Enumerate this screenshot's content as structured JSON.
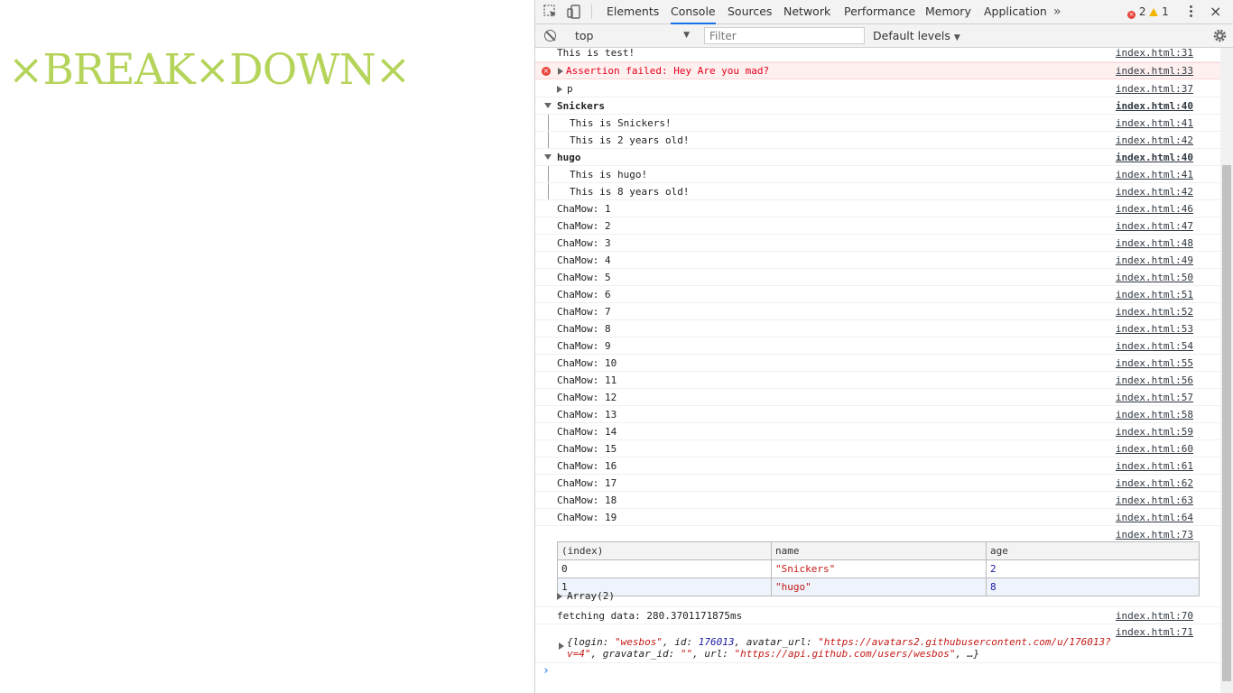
{
  "page": {
    "title": "×BREAK×DOWN×"
  },
  "devtools": {
    "tabs": [
      {
        "label": "Elements"
      },
      {
        "label": "Console"
      },
      {
        "label": "Sources"
      },
      {
        "label": "Network"
      },
      {
        "label": "Performance"
      },
      {
        "label": "Memory"
      },
      {
        "label": "Application"
      }
    ],
    "more_tabs": "»",
    "error_count": "2",
    "warning_count": "1",
    "close": "×",
    "colors": {
      "accent": "#1a73e8",
      "error": "#e8453c",
      "warning": "#f4b400"
    }
  },
  "toolbar": {
    "context": "top",
    "filter_placeholder": "Filter",
    "levels": "Default levels"
  },
  "console": {
    "messages": [
      {
        "text": "This is test!",
        "src": "index.html:31"
      },
      {
        "text": "Assertion failed: Hey Are you mad?",
        "src": "index.html:33"
      },
      {
        "text": "p",
        "src": "index.html:37"
      },
      {
        "text": "Snickers",
        "src": "index.html:40"
      },
      {
        "text": "This is Snickers!",
        "src": "index.html:41"
      },
      {
        "text": "This is 2 years old!",
        "src": "index.html:42"
      },
      {
        "text": "hugo",
        "src": "index.html:40"
      },
      {
        "text": "This is hugo!",
        "src": "index.html:41"
      },
      {
        "text": "This is 8 years old!",
        "src": "index.html:42"
      }
    ],
    "chamow": [
      {
        "text": "ChaMow: 1",
        "src": "index.html:46"
      },
      {
        "text": "ChaMow: 2",
        "src": "index.html:47"
      },
      {
        "text": "ChaMow: 3",
        "src": "index.html:48"
      },
      {
        "text": "ChaMow: 4",
        "src": "index.html:49"
      },
      {
        "text": "ChaMow: 5",
        "src": "index.html:50"
      },
      {
        "text": "ChaMow: 6",
        "src": "index.html:51"
      },
      {
        "text": "ChaMow: 7",
        "src": "index.html:52"
      },
      {
        "text": "ChaMow: 8",
        "src": "index.html:53"
      },
      {
        "text": "ChaMow: 9",
        "src": "index.html:54"
      },
      {
        "text": "ChaMow: 10",
        "src": "index.html:55"
      },
      {
        "text": "ChaMow: 11",
        "src": "index.html:56"
      },
      {
        "text": "ChaMow: 12",
        "src": "index.html:57"
      },
      {
        "text": "ChaMow: 13",
        "src": "index.html:58"
      },
      {
        "text": "ChaMow: 14",
        "src": "index.html:59"
      },
      {
        "text": "ChaMow: 15",
        "src": "index.html:60"
      },
      {
        "text": "ChaMow: 16",
        "src": "index.html:61"
      },
      {
        "text": "ChaMow: 17",
        "src": "index.html:62"
      },
      {
        "text": "ChaMow: 18",
        "src": "index.html:63"
      },
      {
        "text": "ChaMow: 19",
        "src": "index.html:64"
      }
    ],
    "table": {
      "src": "index.html:73",
      "headers": [
        "(index)",
        "name",
        "age"
      ],
      "rows": [
        [
          "0",
          "\"Snickers\"",
          "2"
        ],
        [
          "1",
          "\"hugo\"",
          "8"
        ]
      ],
      "array_label": "Array(2)"
    },
    "timer": {
      "text": "fetching data: 280.3701171875ms",
      "src": "index.html:70"
    },
    "object": {
      "src": "index.html:71",
      "line1_open": "{login: ",
      "login": "\"wesbos\"",
      "id_key": ", id: ",
      "id": "176013",
      "avatar_key": ", avatar_url: ",
      "avatar_1": "\"https://avatars2.githubusercontent.com/u/176013?",
      "avatar_2": "v=4\"",
      "gravatar_key": ", gravatar_id: ",
      "gravatar": "\"\"",
      "url_key": ", url: ",
      "url": "\"https://api.github.com/users/wesbos\"",
      "tail": ", …}"
    },
    "prompt": "›"
  }
}
